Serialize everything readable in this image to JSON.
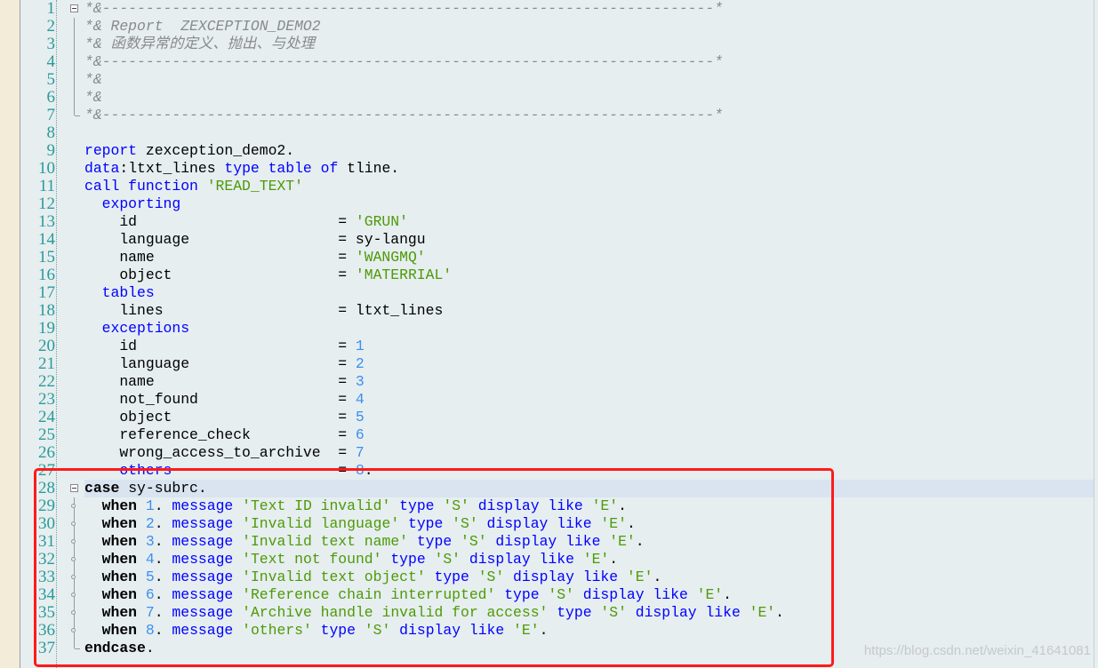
{
  "colors": {
    "keyword": "#0000ff",
    "string": "#4e9a06",
    "number": "#3a8ff0",
    "comment": "#8a8a8a",
    "line_number": "#2b9a9a",
    "highlight_box": "#ff1a1a",
    "current_line": "#d9e4f0"
  },
  "current_line": 28,
  "highlight_box_lines": [
    28,
    37
  ],
  "watermark": "https://blog.csdn.net/weixin_41641081",
  "lines": [
    {
      "no": "1",
      "fold": "open",
      "tokens": [
        [
          "c",
          "*&----------------------------------------------------------------------*"
        ]
      ]
    },
    {
      "no": "2",
      "fold": "bar",
      "tokens": [
        [
          "c",
          "*& Report  ZEXCEPTION_DEMO2"
        ]
      ]
    },
    {
      "no": "3",
      "fold": "bar",
      "tokens": [
        [
          "c",
          "*& 函数异常的定义、抛出、与处理"
        ]
      ]
    },
    {
      "no": "4",
      "fold": "bar",
      "tokens": [
        [
          "c",
          "*&----------------------------------------------------------------------*"
        ]
      ]
    },
    {
      "no": "5",
      "fold": "bar",
      "tokens": [
        [
          "c",
          "*&"
        ]
      ]
    },
    {
      "no": "6",
      "fold": "bar",
      "tokens": [
        [
          "c",
          "*&"
        ]
      ]
    },
    {
      "no": "7",
      "fold": "end",
      "tokens": [
        [
          "c",
          "*&----------------------------------------------------------------------*"
        ]
      ]
    },
    {
      "no": "8",
      "tokens": []
    },
    {
      "no": "9",
      "tokens": [
        [
          "k",
          "report"
        ],
        [
          "t",
          " zexception_demo2."
        ]
      ]
    },
    {
      "no": "10",
      "tokens": [
        [
          "k",
          "data"
        ],
        [
          "t",
          ":ltxt_lines "
        ],
        [
          "k",
          "type table of"
        ],
        [
          "t",
          " tline."
        ]
      ]
    },
    {
      "no": "11",
      "tokens": [
        [
          "k",
          "call function"
        ],
        [
          "s",
          " 'READ_TEXT'"
        ]
      ]
    },
    {
      "no": "12",
      "tokens": [
        [
          "k",
          "  exporting"
        ]
      ]
    },
    {
      "no": "13",
      "tokens": [
        [
          "t",
          "    id                       = "
        ],
        [
          "s",
          "'GRUN'"
        ]
      ]
    },
    {
      "no": "14",
      "tokens": [
        [
          "t",
          "    language                 = sy-langu"
        ]
      ]
    },
    {
      "no": "15",
      "tokens": [
        [
          "t",
          "    name                     = "
        ],
        [
          "s",
          "'WANGMQ'"
        ]
      ]
    },
    {
      "no": "16",
      "tokens": [
        [
          "t",
          "    object                   = "
        ],
        [
          "s",
          "'MATERRIAL'"
        ]
      ]
    },
    {
      "no": "17",
      "tokens": [
        [
          "k",
          "  tables"
        ]
      ]
    },
    {
      "no": "18",
      "tokens": [
        [
          "t",
          "    lines                    = ltxt_lines"
        ]
      ]
    },
    {
      "no": "19",
      "tokens": [
        [
          "k",
          "  exceptions"
        ]
      ]
    },
    {
      "no": "20",
      "tokens": [
        [
          "t",
          "    id                       = "
        ],
        [
          "n",
          "1"
        ]
      ]
    },
    {
      "no": "21",
      "tokens": [
        [
          "t",
          "    language                 = "
        ],
        [
          "n",
          "2"
        ]
      ]
    },
    {
      "no": "22",
      "tokens": [
        [
          "t",
          "    name                     = "
        ],
        [
          "n",
          "3"
        ]
      ]
    },
    {
      "no": "23",
      "tokens": [
        [
          "t",
          "    not_found                = "
        ],
        [
          "n",
          "4"
        ]
      ]
    },
    {
      "no": "24",
      "tokens": [
        [
          "t",
          "    object                   = "
        ],
        [
          "n",
          "5"
        ]
      ]
    },
    {
      "no": "25",
      "tokens": [
        [
          "t",
          "    reference_check          = "
        ],
        [
          "n",
          "6"
        ]
      ]
    },
    {
      "no": "26",
      "tokens": [
        [
          "t",
          "    wrong_access_to_archive  = "
        ],
        [
          "n",
          "7"
        ]
      ]
    },
    {
      "no": "27",
      "tokens": [
        [
          "k",
          "    others"
        ],
        [
          "t",
          "                   = "
        ],
        [
          "n",
          "8"
        ],
        [
          "t",
          "."
        ]
      ]
    },
    {
      "no": "28",
      "fold": "open",
      "tokens": [
        [
          "b",
          "case"
        ],
        [
          "t",
          " sy-subrc."
        ]
      ]
    },
    {
      "no": "29",
      "fold": "dot",
      "tokens": [
        [
          "b",
          "  when"
        ],
        [
          "n",
          " 1"
        ],
        [
          "t",
          ". "
        ],
        [
          "k",
          "message"
        ],
        [
          "s",
          " 'Text ID invalid'"
        ],
        [
          "k",
          " type"
        ],
        [
          "s",
          " 'S'"
        ],
        [
          "k",
          " display like"
        ],
        [
          "s",
          " 'E'"
        ],
        [
          "t",
          "."
        ]
      ]
    },
    {
      "no": "30",
      "fold": "dot",
      "tokens": [
        [
          "b",
          "  when"
        ],
        [
          "n",
          " 2"
        ],
        [
          "t",
          ". "
        ],
        [
          "k",
          "message"
        ],
        [
          "s",
          " 'Invalid language'"
        ],
        [
          "k",
          " type"
        ],
        [
          "s",
          " 'S'"
        ],
        [
          "k",
          " display like"
        ],
        [
          "s",
          " 'E'"
        ],
        [
          "t",
          "."
        ]
      ]
    },
    {
      "no": "31",
      "fold": "dot",
      "tokens": [
        [
          "b",
          "  when"
        ],
        [
          "n",
          " 3"
        ],
        [
          "t",
          ". "
        ],
        [
          "k",
          "message"
        ],
        [
          "s",
          " 'Invalid text name'"
        ],
        [
          "k",
          " type"
        ],
        [
          "s",
          " 'S'"
        ],
        [
          "k",
          " display like"
        ],
        [
          "s",
          " 'E'"
        ],
        [
          "t",
          "."
        ]
      ]
    },
    {
      "no": "32",
      "fold": "dot",
      "tokens": [
        [
          "b",
          "  when"
        ],
        [
          "n",
          " 4"
        ],
        [
          "t",
          ". "
        ],
        [
          "k",
          "message"
        ],
        [
          "s",
          " 'Text not found'"
        ],
        [
          "k",
          " type"
        ],
        [
          "s",
          " 'S'"
        ],
        [
          "k",
          " display like"
        ],
        [
          "s",
          " 'E'"
        ],
        [
          "t",
          "."
        ]
      ]
    },
    {
      "no": "33",
      "fold": "dot",
      "tokens": [
        [
          "b",
          "  when"
        ],
        [
          "n",
          " 5"
        ],
        [
          "t",
          ". "
        ],
        [
          "k",
          "message"
        ],
        [
          "s",
          " 'Invalid text object'"
        ],
        [
          "k",
          " type"
        ],
        [
          "s",
          " 'S'"
        ],
        [
          "k",
          " display like"
        ],
        [
          "s",
          " 'E'"
        ],
        [
          "t",
          "."
        ]
      ]
    },
    {
      "no": "34",
      "fold": "dot",
      "tokens": [
        [
          "b",
          "  when"
        ],
        [
          "n",
          " 6"
        ],
        [
          "t",
          ". "
        ],
        [
          "k",
          "message"
        ],
        [
          "s",
          " 'Reference chain interrupted'"
        ],
        [
          "k",
          " type"
        ],
        [
          "s",
          " 'S'"
        ],
        [
          "k",
          " display like"
        ],
        [
          "s",
          " 'E'"
        ],
        [
          "t",
          "."
        ]
      ]
    },
    {
      "no": "35",
      "fold": "dot",
      "tokens": [
        [
          "b",
          "  when"
        ],
        [
          "n",
          " 7"
        ],
        [
          "t",
          ". "
        ],
        [
          "k",
          "message"
        ],
        [
          "s",
          " 'Archive handle invalid for access'"
        ],
        [
          "k",
          " type"
        ],
        [
          "s",
          " 'S'"
        ],
        [
          "k",
          " display like"
        ],
        [
          "s",
          " 'E'"
        ],
        [
          "t",
          "."
        ]
      ]
    },
    {
      "no": "36",
      "fold": "dot",
      "tokens": [
        [
          "b",
          "  when"
        ],
        [
          "n",
          " 8"
        ],
        [
          "t",
          ". "
        ],
        [
          "k",
          "message"
        ],
        [
          "s",
          " 'others'"
        ],
        [
          "k",
          " type"
        ],
        [
          "s",
          " 'S'"
        ],
        [
          "k",
          " display like"
        ],
        [
          "s",
          " 'E'"
        ],
        [
          "t",
          "."
        ]
      ]
    },
    {
      "no": "37",
      "fold": "end",
      "tokens": [
        [
          "b",
          "endcase"
        ],
        [
          "t",
          "."
        ]
      ]
    }
  ]
}
